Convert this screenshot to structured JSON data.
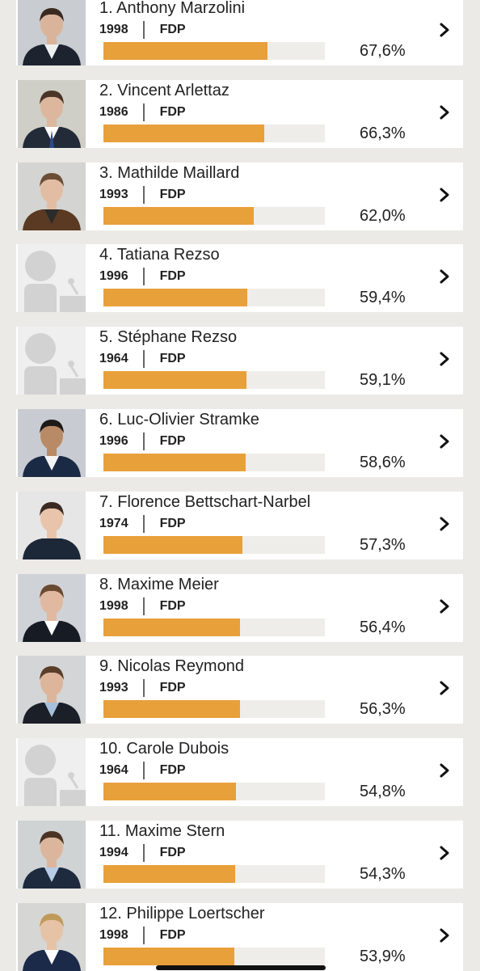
{
  "accent_color": "#e8a03a",
  "candidates": [
    {
      "name": "1. Anthony Marzolini",
      "year": "1998",
      "party": "FDP",
      "percent_label": "67,6%",
      "share": 0.676,
      "photo": "photo",
      "icon": "chevron-right-icon"
    },
    {
      "name": "2. Vincent Arlettaz",
      "year": "1986",
      "party": "FDP",
      "percent_label": "66,3%",
      "share": 0.663,
      "photo": "photo",
      "icon": "chevron-right-icon"
    },
    {
      "name": "3. Mathilde Maillard",
      "year": "1993",
      "party": "FDP",
      "percent_label": "62,0%",
      "share": 0.62,
      "photo": "photo",
      "icon": "chevron-right-icon"
    },
    {
      "name": "4. Tatiana Rezso",
      "year": "1996",
      "party": "FDP",
      "percent_label": "59,4%",
      "share": 0.594,
      "photo": "placeholder",
      "icon": "chevron-right-icon"
    },
    {
      "name": "5. Stéphane Rezso",
      "year": "1964",
      "party": "FDP",
      "percent_label": "59,1%",
      "share": 0.591,
      "photo": "placeholder",
      "icon": "chevron-right-icon"
    },
    {
      "name": "6. Luc-Olivier Stramke",
      "year": "1996",
      "party": "FDP",
      "percent_label": "58,6%",
      "share": 0.586,
      "photo": "photo",
      "icon": "chevron-right-icon"
    },
    {
      "name": "7. Florence Bettschart-Narbel",
      "year": "1974",
      "party": "FDP",
      "percent_label": "57,3%",
      "share": 0.573,
      "photo": "photo",
      "icon": "chevron-right-icon"
    },
    {
      "name": "8. Maxime Meier",
      "year": "1998",
      "party": "FDP",
      "percent_label": "56,4%",
      "share": 0.564,
      "photo": "photo",
      "icon": "chevron-right-icon"
    },
    {
      "name": "9. Nicolas Reymond",
      "year": "1993",
      "party": "FDP",
      "percent_label": "56,3%",
      "share": 0.563,
      "photo": "photo",
      "icon": "chevron-right-icon"
    },
    {
      "name": "10. Carole Dubois",
      "year": "1964",
      "party": "FDP",
      "percent_label": "54,8%",
      "share": 0.548,
      "photo": "placeholder",
      "icon": "chevron-right-icon"
    },
    {
      "name": "11. Maxime Stern",
      "year": "1994",
      "party": "FDP",
      "percent_label": "54,3%",
      "share": 0.543,
      "photo": "photo",
      "icon": "chevron-right-icon"
    },
    {
      "name": "12. Philippe Loertscher",
      "year": "1998",
      "party": "FDP",
      "percent_label": "53,9%",
      "share": 0.539,
      "photo": "photo",
      "icon": "chevron-right-icon"
    }
  ]
}
